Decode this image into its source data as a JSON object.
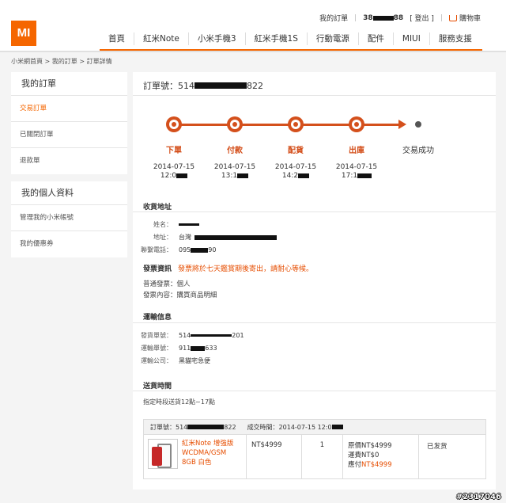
{
  "header": {
    "logo": "MI",
    "my_orders": "我的訂單",
    "user_prefix": "38",
    "user_suffix": "88",
    "logout": "[ 登出 ]",
    "cart": "購物車",
    "nav": [
      "首頁",
      "紅米Note",
      "小米手機3",
      "紅米手機1S",
      "行動電源",
      "配件",
      "MIUI",
      "服務支援"
    ]
  },
  "breadcrumb": "小米網首頁 > 我的訂單 > 訂單詳情",
  "sidebar": {
    "orders_title": "我的訂單",
    "orders_items": [
      "交易訂單",
      "已關閉訂單",
      "退款單"
    ],
    "profile_title": "我的個人資料",
    "profile_items": [
      "管理我的小米帳號",
      "我的優惠券"
    ]
  },
  "order": {
    "number_label": "訂單號：514",
    "number_suffix": "822",
    "steps": [
      {
        "name": "下單",
        "date": "2014-07-15",
        "time": "12:0"
      },
      {
        "name": "付款",
        "date": "2014-07-15",
        "time": "13:1"
      },
      {
        "name": "配貨",
        "date": "2014-07-15",
        "time": "14:2"
      },
      {
        "name": "出庫",
        "date": "2014-07-15",
        "time": "17:1"
      },
      {
        "name": "交易成功",
        "date": "",
        "time": ""
      }
    ]
  },
  "address": {
    "title": "收貨地址",
    "name_label": "姓名：",
    "addr_label": "地址：",
    "addr_prefix": "台灣",
    "phone_label": "聯繫電話：",
    "phone_prefix": "095",
    "phone_suffix": "90"
  },
  "invoice": {
    "title": "發票資訊",
    "note": "發票將於七天鑑賞期後寄出，請耐心等候。",
    "type": "普通發票：個人",
    "content": "發票內容：購買商品明細"
  },
  "shipping": {
    "title": "運輸信息",
    "invoice_no_label": "發貨單號：",
    "invoice_no_prefix": "514",
    "invoice_no_suffix": "201",
    "tracking_label": "運輸單號：",
    "tracking_prefix": "911",
    "tracking_suffix": "633",
    "company_label": "運輸公司：",
    "company": "黑貓宅急便"
  },
  "delivery": {
    "title": "送貨時間",
    "value": "指定時段送貨12點~17點"
  },
  "table": {
    "order_label": "訂單號：514",
    "order_suffix": "822",
    "time_label": "成交時間：2014-07-15 12:0",
    "product_name": "紅米Note 增強版 WCDMA/GSM 8GB 白色",
    "price": "NT$4999",
    "qty": "1",
    "orig_price": "原價NT$4999",
    "shipping_fee": "運費NT$0",
    "pay_label": "應付",
    "pay_amount": "NT$4999",
    "status": "已发货"
  },
  "watermark": "#2317046"
}
